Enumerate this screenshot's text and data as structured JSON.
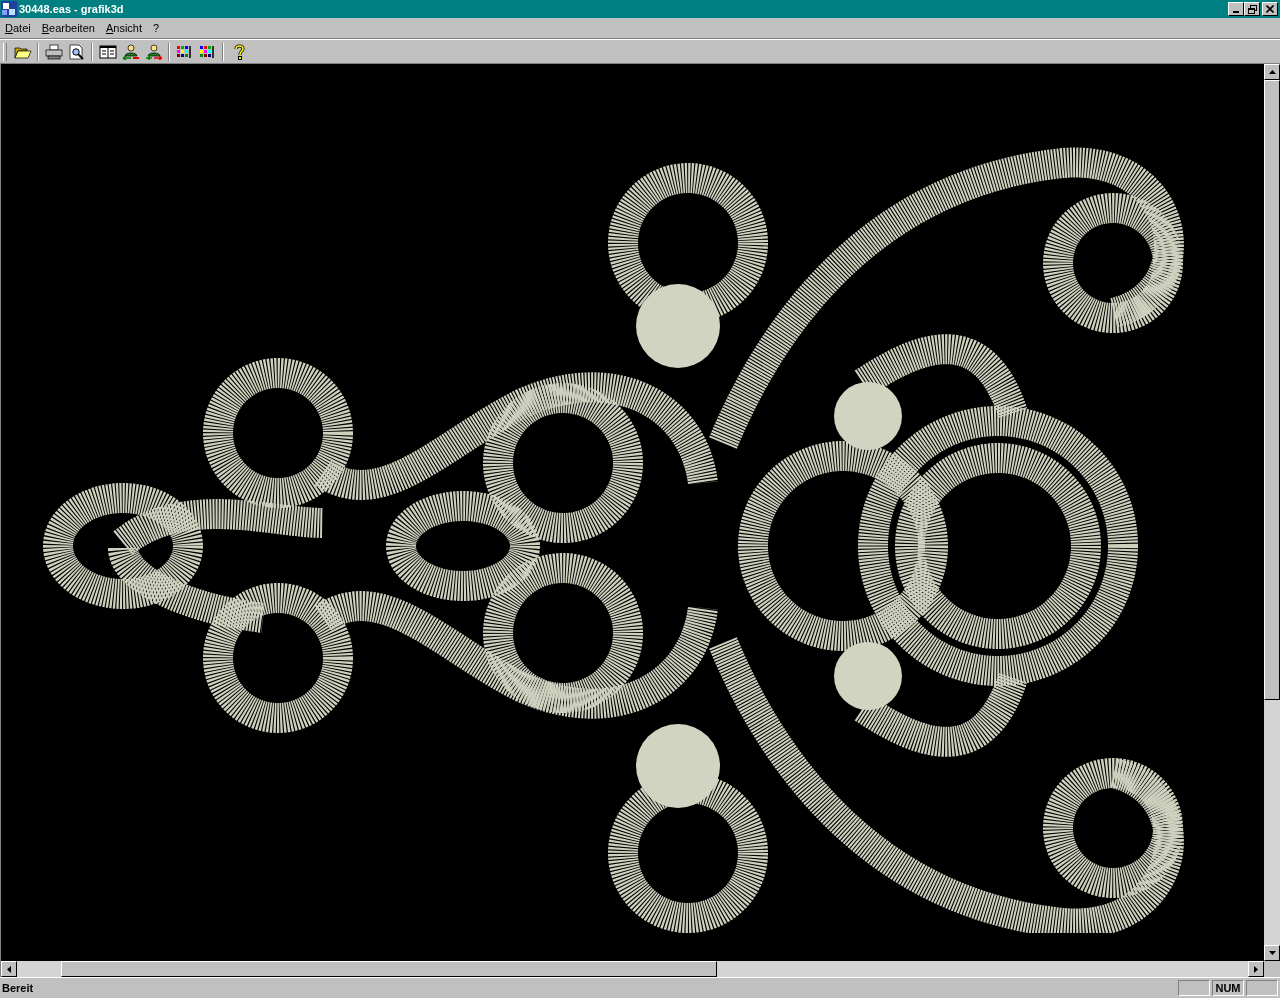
{
  "window": {
    "title": "30448.eas - grafik3d"
  },
  "menu": [
    "Datei",
    "Bearbeiten",
    "Ansicht",
    "?"
  ],
  "status_bar": {
    "text": "Bereit",
    "indicators": [
      "NUM"
    ]
  }
}
